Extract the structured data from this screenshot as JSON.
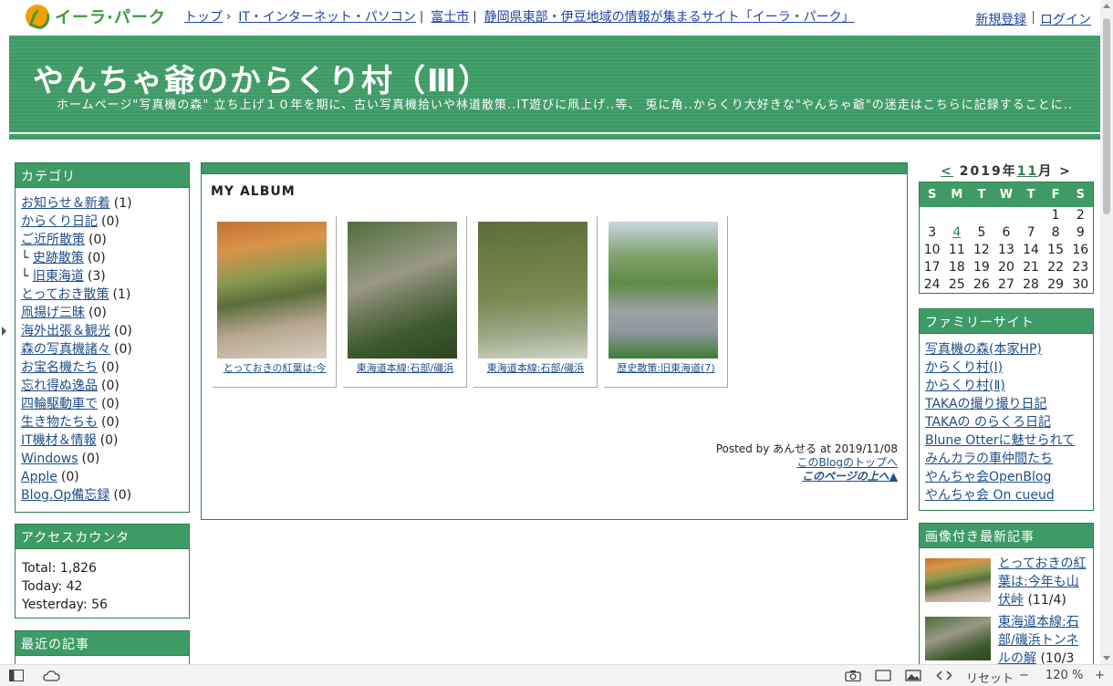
{
  "portal": {
    "logo_text": "イーラ·パーク",
    "breadcrumbs": [
      {
        "label": "トップ",
        "sep": "›"
      },
      {
        "label": "IT・インターネット・パソコン",
        "sep": "|"
      },
      {
        "label": "富士市",
        "sep": "|"
      },
      {
        "label": "静岡県東部・伊豆地域の情報が集まるサイト「イーラ・パーク」",
        "sep": ""
      }
    ],
    "register": "新規登録",
    "login": "ログイン"
  },
  "header": {
    "title": "やんちゃ爺のからくり村（Ⅲ）",
    "description": "ホームページ\"写真機の森\" 立ち上げ１０年を期に、古い写真機拾いや林道散策..IT遊びに凧上げ..等、 兎に角..からくり大好きな\"やんちゃ爺\"の迷走はこちらに記録することに.."
  },
  "sidebar": {
    "categories_title": "カテゴリ",
    "categories": [
      {
        "prefix": "",
        "label": "お知らせ＆新着",
        "count": "(1)"
      },
      {
        "prefix": "",
        "label": "からくり日記",
        "count": "(0)"
      },
      {
        "prefix": "",
        "label": "ご近所散策",
        "count": "(0)"
      },
      {
        "prefix": "└ ",
        "label": "史跡散策",
        "count": "(0)"
      },
      {
        "prefix": "└ ",
        "label": "旧東海道",
        "count": "(3)"
      },
      {
        "prefix": "",
        "label": "とっておき散策",
        "count": "(1)"
      },
      {
        "prefix": "",
        "label": "凧揚げ三昧",
        "count": "(0)"
      },
      {
        "prefix": "",
        "label": "海外出張＆観光",
        "count": "(0)"
      },
      {
        "prefix": "",
        "label": "森の写真機諸々",
        "count": "(0)"
      },
      {
        "prefix": "",
        "label": "お宝名機たち",
        "count": "(0)"
      },
      {
        "prefix": "",
        "label": "忘れ得ぬ逸品",
        "count": "(0)"
      },
      {
        "prefix": "",
        "label": "四輪駆動車で",
        "count": "(0)"
      },
      {
        "prefix": "",
        "label": "生き物たちも",
        "count": "(0)"
      },
      {
        "prefix": "",
        "label": "IT機材＆情報",
        "count": "(0)"
      },
      {
        "prefix": "",
        "label": "Windows",
        "count": "(0)"
      },
      {
        "prefix": "",
        "label": "Apple",
        "count": "(0)"
      },
      {
        "prefix": "",
        "label": "Blog.Op備忘録",
        "count": "(0)"
      }
    ],
    "counter_title": "アクセスカウンタ",
    "total": "Total: 1,826",
    "today": "Today: 42",
    "yesterday": "Yesterday: 56",
    "recent_title": "最近の記事"
  },
  "post": {
    "title": "MY ALBUM",
    "photos": [
      {
        "caption": "とっておきの紅葉は:今"
      },
      {
        "caption": "東海道本線:石部/磯浜"
      },
      {
        "caption": "東海道本線:石部/磯浜"
      },
      {
        "caption": "歴史散策:旧東海道(7)"
      }
    ],
    "posted_by": "Posted by あんせる at 2019/11/08",
    "blog_top": "このBlogのトップへ",
    "page_top": "このページの上へ▲"
  },
  "calendar": {
    "prev": "<",
    "year_label": "2019年",
    "month": "11",
    "month_suffix": "月",
    "next": ">",
    "weekdays": [
      "S",
      "M",
      "T",
      "W",
      "T",
      "F",
      "S"
    ],
    "weeks": [
      [
        "",
        "",
        "",
        "",
        "",
        "1",
        "2"
      ],
      [
        "3",
        "4",
        "5",
        "6",
        "7",
        "8",
        "9"
      ],
      [
        "10",
        "11",
        "12",
        "13",
        "14",
        "15",
        "16"
      ],
      [
        "17",
        "18",
        "19",
        "20",
        "21",
        "22",
        "23"
      ],
      [
        "24",
        "25",
        "26",
        "27",
        "28",
        "29",
        "30"
      ]
    ],
    "linked_day": "4"
  },
  "family": {
    "title": "ファミリーサイト",
    "links": [
      "写真機の森(本家HP)",
      "からくり村(Ⅰ)",
      "からくり村(Ⅱ)",
      "TAKAの撮り撮り日記",
      "TAKAの のらくろ日記",
      "Blune Otterに魅せられて",
      "みんカラの車仲間たち",
      "やんちゃ会OpenBlog",
      "やんちゃ会 On cueud"
    ]
  },
  "recent_images": {
    "title": "画像付き最新記事",
    "items": [
      {
        "link": "とっておきの紅葉は:今年も山伏峠",
        "date": "(11/4)"
      },
      {
        "link": "東海道本線:石部/磯浜トンネルの解",
        "date": "(10/3"
      }
    ]
  },
  "statusbar": {
    "reset": "リセット",
    "minus": "−",
    "zoom": "120 %",
    "plus": "+"
  },
  "colors": {
    "accent_green": "#3f9b66",
    "link_blue": "#1f4e8a"
  }
}
